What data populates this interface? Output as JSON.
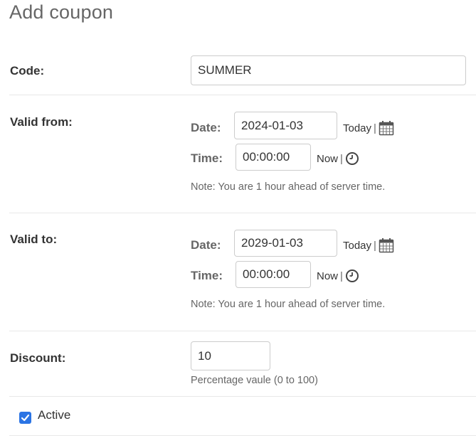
{
  "page": {
    "title": "Add coupon"
  },
  "code": {
    "label": "Code:",
    "value": "SUMMER"
  },
  "valid_from": {
    "label": "Valid from:",
    "date_label": "Date:",
    "date_value": "2024-01-03",
    "today_link": "Today",
    "separator": "|",
    "time_label": "Time:",
    "time_value": "00:00:00",
    "now_link": "Now",
    "note": "Note: You are 1 hour ahead of server time."
  },
  "valid_to": {
    "label": "Valid to:",
    "date_label": "Date:",
    "date_value": "2029-01-03",
    "today_link": "Today",
    "separator": "|",
    "time_label": "Time:",
    "time_value": "00:00:00",
    "now_link": "Now",
    "note": "Note: You are 1 hour ahead of server time."
  },
  "discount": {
    "label": "Discount:",
    "value": "10",
    "help": "Percentage vaule (0 to 100)"
  },
  "active": {
    "label": "Active",
    "checked": true
  },
  "icons": {
    "calendar": "calendar-icon",
    "clock": "clock-icon",
    "checkbox_check": "checkmark-icon"
  },
  "colors": {
    "accent": "#2b74e4",
    "divider": "#e8e8e8",
    "muted": "#666666"
  }
}
